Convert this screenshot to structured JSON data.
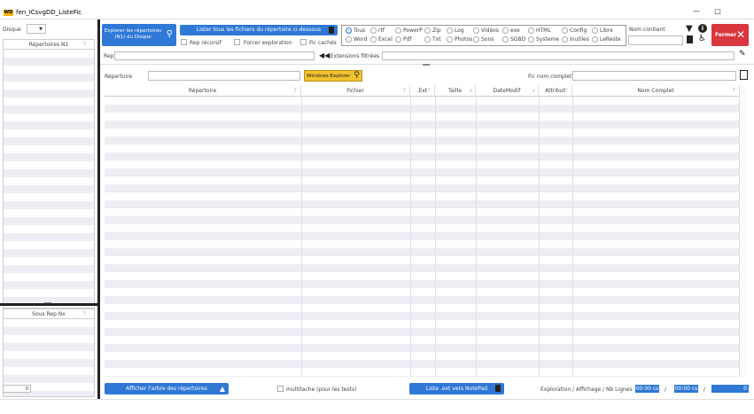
{
  "window": {
    "logo": "WD",
    "title": "fen_ICsvgDD_ListeFic",
    "minimize": "—",
    "maximize": "□"
  },
  "left": {
    "disque_label": "Disque",
    "rep_n1_header": "Répertoires N1",
    "rep_n1_count": "0",
    "sous_rep_header": "Sous Rep Nx",
    "sous_rep_count": "0"
  },
  "toolbar": {
    "explorer_btn": "Explorer les répertoires (N1) du Disque",
    "lister_btn": "Lister tous les fichiers du répertoire ci-dessous",
    "rep_recursif": "Rep récursif",
    "forcer_exploration": "Forcer exploration",
    "fic_caches": "Fic cachés",
    "nom_contient_label": "Nom contient",
    "fermer_btn": "Fermer",
    "rep_label": "Rep",
    "extensions_filtrees": "Extensions filtrées"
  },
  "filters": {
    "row1": [
      "Tous",
      "rtf",
      "PowerP",
      "Zip",
      "Log",
      "Vidéos",
      "exe",
      "HTML",
      "Config",
      "Libre"
    ],
    "row2": [
      "Word",
      "Excel",
      "Pdf",
      "Txt",
      "Photos",
      "Sons",
      "SGBD",
      "Systeme",
      "Inutiles",
      "LeReste"
    ],
    "selected": "Tous"
  },
  "search": {
    "repertoire_label": "Répertoire",
    "windows_explorer_btn": "Windows-Explorer",
    "fic_nom_complet_label": "Fic nom complet"
  },
  "grid": {
    "columns": [
      "Répertoire",
      "Fichier",
      ".Ext",
      "Taille",
      "DateModif",
      "Attribut",
      "Nom Complet"
    ]
  },
  "bottom": {
    "afficher_arbre_btn": "Afficher l'arbre des répertoires",
    "multitache": "multitache (pour les tests)",
    "liste_ext_btn": "Liste .ext vers NotePad",
    "stats_label": "Exploration / Affichage / Nb Lignes",
    "time1": "00:00 cs",
    "time2": "00:00 cs",
    "sep": "/",
    "nb_lignes": "0"
  },
  "colors": {
    "accent": "#2f78d6",
    "close": "#d9363e",
    "windows_btn": "#f2c12e",
    "separator": "#222222"
  }
}
